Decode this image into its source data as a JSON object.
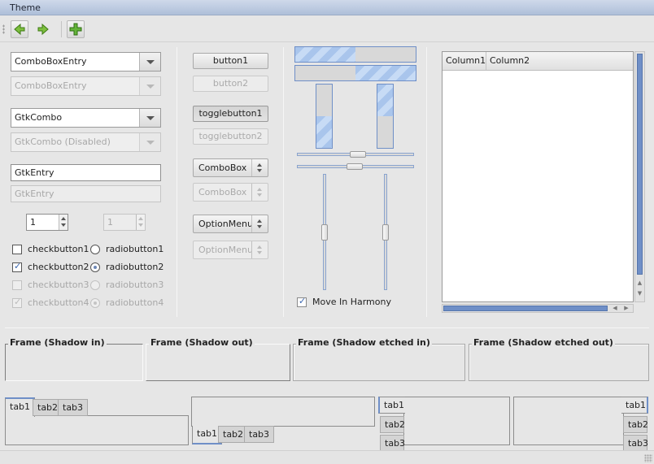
{
  "window": {
    "title": "Theme"
  },
  "toolbar": {
    "items": [
      "back-arrow",
      "forward-arrow",
      "add-plus"
    ]
  },
  "colors": {
    "accent": "#6f8fc7",
    "progress": "#a9c5ec",
    "window_bg": "#e6e6e6",
    "titlebar": "#aebfd9"
  },
  "col1": {
    "combo_entry": "ComboBoxEntry",
    "combo_entry_disabled": "ComboBoxEntry",
    "gtk_combo": "GtkCombo",
    "gtk_combo_disabled": "GtkCombo (Disabled)",
    "gtk_entry": "GtkEntry",
    "gtk_entry_disabled": "GtkEntry",
    "spin_value": "1",
    "spin_value_disabled": "1",
    "check": [
      "checkbutton1",
      "checkbutton2",
      "checkbutton3",
      "checkbutton4"
    ],
    "radio": [
      "radiobutton1",
      "radiobutton2",
      "radiobutton3",
      "radiobutton4"
    ]
  },
  "col2": {
    "button1": "button1",
    "button2": "button2",
    "toggle1": "togglebutton1",
    "toggle2": "togglebutton2",
    "combobox": "ComboBox",
    "combobox_disabled": "ComboBox",
    "optionmenu": "OptionMenu",
    "optionmenu_disabled": "OptionMenu"
  },
  "col3": {
    "progress": {
      "horizontal_1": 0.5,
      "horizontal_2": 0.5,
      "vertical_1": 0.5,
      "vertical_2": 0.5
    },
    "scales": {
      "horizontal_1": 0.5,
      "horizontal_2": 0.5,
      "vertical_1": 0.5,
      "vertical_2": 0.5
    },
    "move_harmony": "Move In Harmony"
  },
  "tree": {
    "columns": [
      "Column1",
      "Column2"
    ]
  },
  "frames": [
    "Frame (Shadow in)",
    "Frame (Shadow out)",
    "Frame (Shadow etched in)",
    "Frame (Shadow etched out)"
  ],
  "tabs": [
    "tab1",
    "tab2",
    "tab3"
  ]
}
